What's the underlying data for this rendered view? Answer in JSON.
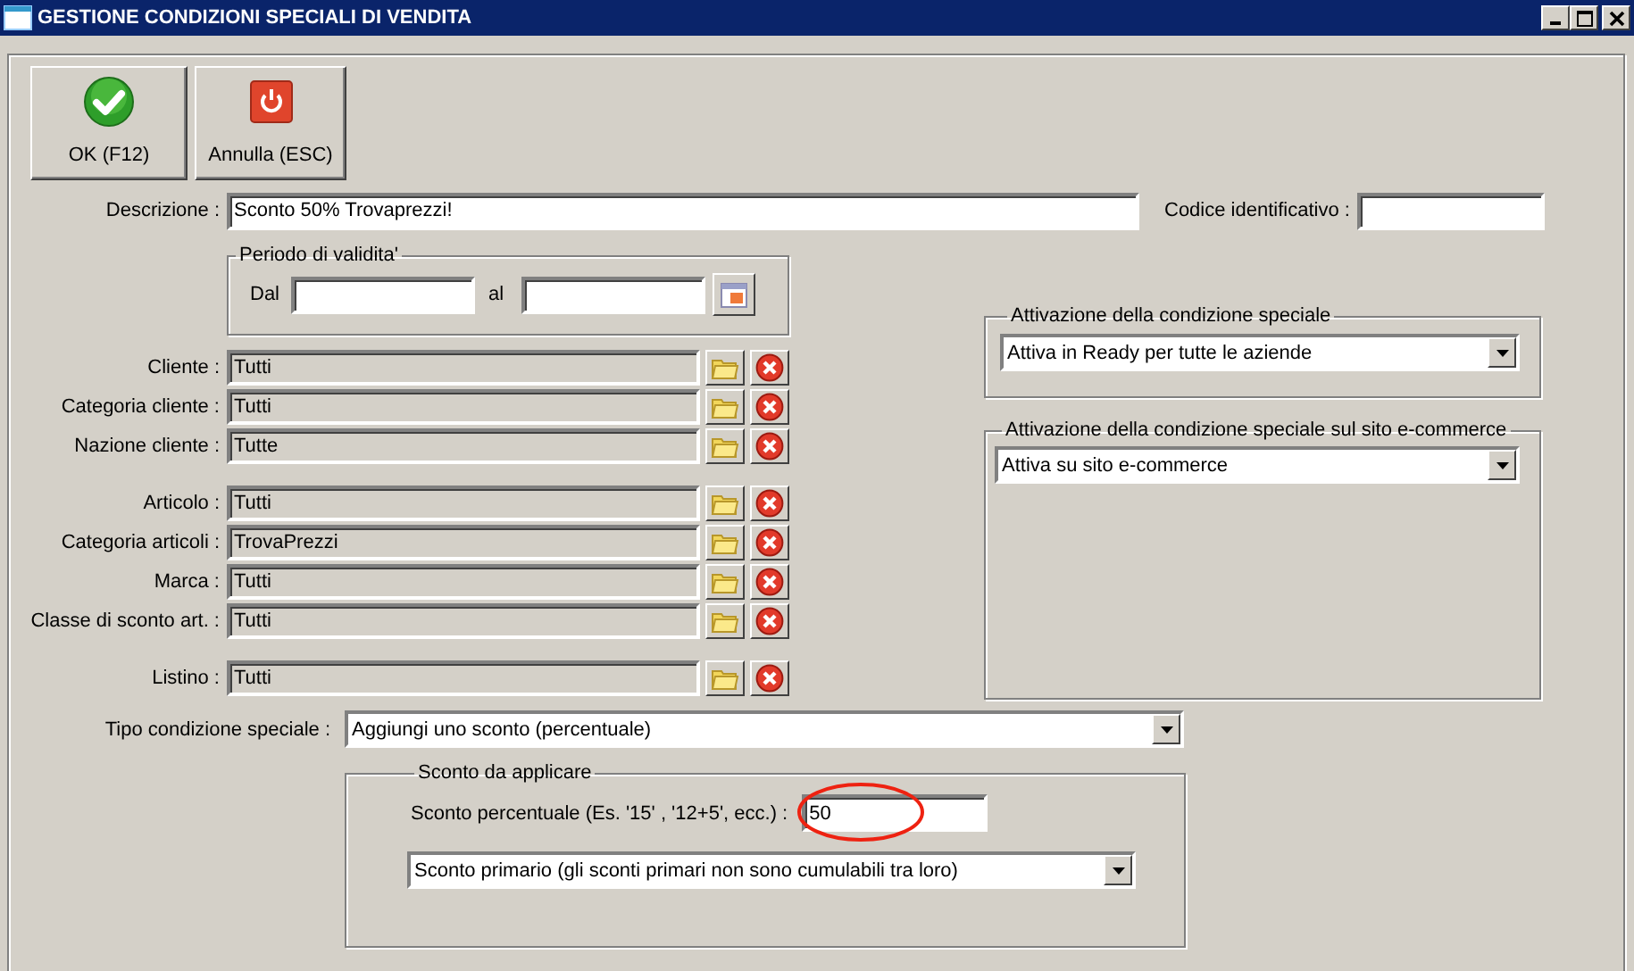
{
  "window": {
    "title": "GESTIONE CONDIZIONI SPECIALI DI VENDITA"
  },
  "toolbar": [
    {
      "kind": "ok",
      "label": "OK (F12)"
    },
    {
      "kind": "cancel",
      "label": "Annulla (ESC)"
    }
  ],
  "description": {
    "label": "Descrizione :",
    "value": "Sconto 50% Trovaprezzi!"
  },
  "code": {
    "label": "Codice identificativo :"
  },
  "period": {
    "legend": "Periodo di validita'",
    "from_label": "Dal",
    "to_label": "al"
  },
  "lookup_sections": [
    {
      "rows": [
        {
          "label": "Cliente :",
          "value": "Tutti"
        },
        {
          "label": "Categoria cliente :",
          "value": "Tutti"
        },
        {
          "label": "Nazione cliente :",
          "value": "Tutte"
        }
      ]
    },
    {
      "rows": [
        {
          "label": "Articolo :",
          "value": "Tutti"
        },
        {
          "label": "Categoria articoli :",
          "value": "TrovaPrezzi"
        },
        {
          "label": "Marca :",
          "value": "Tutti"
        },
        {
          "label": "Classe di sconto art. :",
          "value": "Tutti"
        }
      ]
    },
    {
      "rows": [
        {
          "label": "Listino :",
          "value": "Tutti"
        }
      ]
    }
  ],
  "activation": {
    "legend": "Attivazione della condizione speciale",
    "value": "Attiva in Ready per tutte le aziende"
  },
  "ecommerce": {
    "legend": "Attivazione della condizione speciale sul sito e-commerce",
    "value": "Attiva su sito e-commerce"
  },
  "condition_type": {
    "label": "Tipo condizione speciale :",
    "value": "Aggiungi uno sconto (percentuale)"
  },
  "discount": {
    "legend": "Sconto da applicare",
    "percent_label": "Sconto percentuale (Es. '15' , '12+5', ecc.) :",
    "percent_value": "50",
    "highlighted": true,
    "mode_value": "Sconto primario (gli sconti primari non sono cumulabili tra loro)"
  }
}
